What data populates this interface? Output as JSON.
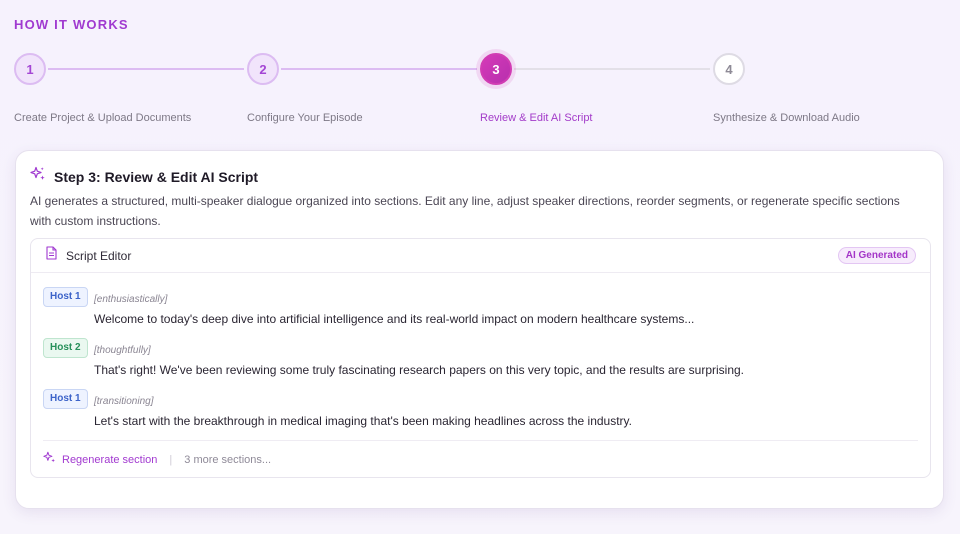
{
  "section_heading": "HOW IT WORKS",
  "steps": [
    {
      "number": "1",
      "label": "Create Project & Upload Documents",
      "state": "done"
    },
    {
      "number": "2",
      "label": "Configure Your Episode",
      "state": "done"
    },
    {
      "number": "3",
      "label": "Review & Edit AI Script",
      "state": "active"
    },
    {
      "number": "4",
      "label": "Synthesize & Download Audio",
      "state": "todo"
    }
  ],
  "card": {
    "title": "Step 3: Review & Edit AI Script",
    "description": "AI generates a structured, multi-speaker dialogue organized into sections. Edit any line, adjust speaker directions, reorder segments, or regenerate specific sections with custom instructions.",
    "editor": {
      "title": "Script Editor",
      "badge": "AI Generated",
      "lines": [
        {
          "speaker": "Host 1",
          "direction": "[enthusiastically]",
          "text": "Welcome to today's deep dive into artificial intelligence and its real-world impact on modern healthcare systems..."
        },
        {
          "speaker": "Host 2",
          "direction": "[thoughtfully]",
          "text": "That's right! We've been reviewing some truly fascinating research papers on this very topic, and the results are surprising."
        },
        {
          "speaker": "Host 1",
          "direction": "[transitioning]",
          "text": "Let's start with the breakthrough in medical imaging that's been making headlines across the industry."
        }
      ],
      "regenerate_label": "Regenerate section",
      "more_sections": "3 more sections..."
    }
  },
  "icons": {
    "title_icon": "sparkles-icon",
    "editor_icon": "document-icon",
    "regenerate_icon": "sparkles-icon"
  },
  "colors": {
    "accent": "#a03ad0",
    "active_step": "#d13cb3",
    "host1": "#3c63c9",
    "host2": "#26905a"
  }
}
